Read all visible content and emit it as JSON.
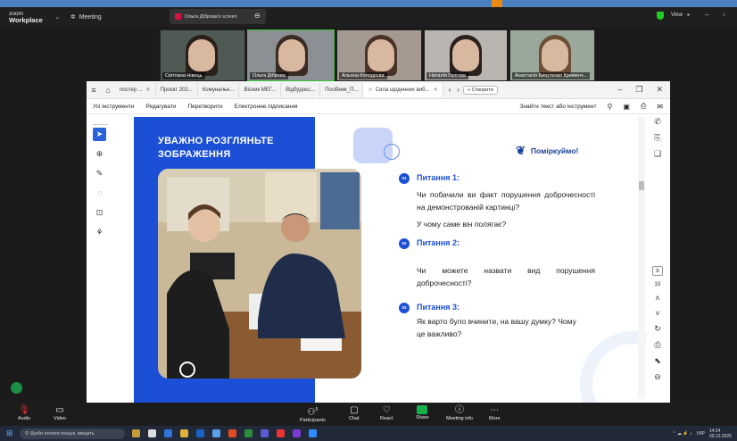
{
  "zoom": {
    "app_name_line1": "zoom",
    "app_name_line2": "Workplace",
    "meeting_label": "Meeting",
    "share_tab_label": "Ольга Діброва's screen",
    "view_label": "View",
    "accent_color": "#1b4fd6"
  },
  "participants": [
    {
      "name": "Світлана Нівець"
    },
    {
      "name": "Ольга Діброва"
    },
    {
      "name": "Альона Колодєєва"
    },
    {
      "name": "Наталія Голгова"
    },
    {
      "name": "Анастасія Бинутенко Кременч..."
    }
  ],
  "browser": {
    "tabs": [
      {
        "label": "постер ..."
      },
      {
        "label": "Проєкт 202..."
      },
      {
        "label": "Комунальн..."
      },
      {
        "label": "Вісник МЕГ..."
      },
      {
        "label": "Відбудоєс..."
      },
      {
        "label": "Посібник_П..."
      },
      {
        "label": "Сила щоденних виб..."
      }
    ],
    "create_button": "+ Створити"
  },
  "toolbar": {
    "items": [
      "Усі інструменти",
      "Редагувати",
      "Перетворити",
      "Електронне підписання"
    ],
    "search_label": "Знайти текст або інструмент"
  },
  "page_indicator": {
    "current": "8",
    "total": "33"
  },
  "slide": {
    "title_line1": "УВАЖНО РОЗГЛЯНЬТЕ",
    "title_line2": "ЗОБРАЖЕННЯ",
    "logo_text": "Поміркуймо!",
    "questions": [
      {
        "num": "01",
        "title": "Питання 1:",
        "text": "Чи побачили ви факт порушення доброчесності на демонстрованій картинці?",
        "extra": "У чому саме він полягає?"
      },
      {
        "num": "02",
        "title": "Питання 2:",
        "text": "Чи можете назвати вид порушення доброчесності?"
      },
      {
        "num": "03",
        "title": "Питання 3:",
        "text": "Як варто було вчинити, на вашу думку? Чому це важливо?"
      }
    ]
  },
  "controls": {
    "audio": "Audio",
    "video": "Video",
    "participants": "Participants",
    "participants_count": "5",
    "chat": "Chat",
    "react": "React",
    "share": "Share",
    "meeting_info": "Meeting info",
    "more": "More"
  },
  "taskbar": {
    "search_placeholder": "Щоби почати пошук, введіть",
    "lang": "УКР",
    "time": "14:24",
    "date": "09.12.2025"
  }
}
